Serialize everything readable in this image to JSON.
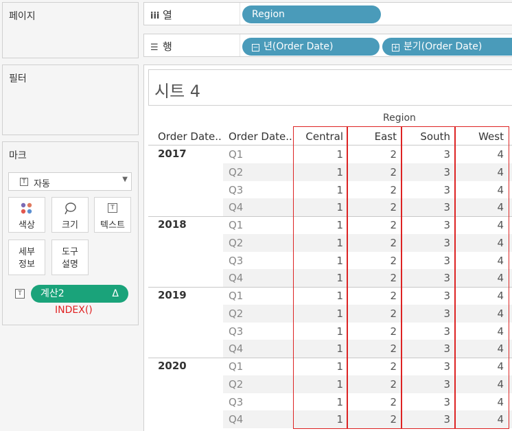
{
  "left_panels": {
    "pages_title": "페이지",
    "filters_title": "필터",
    "marks_title": "마크"
  },
  "marks": {
    "type_label": "자동",
    "buttons": {
      "color": "색상",
      "size": "크기",
      "text": "텍스트",
      "detail_line1": "세부",
      "detail_line2": "정보",
      "tooltip_line1": "도구",
      "tooltip_line2": "설명"
    },
    "calc_pill": "계산2",
    "calc_delta": "Δ",
    "calc_formula": "INDEX()"
  },
  "shelves": {
    "columns_label": "열",
    "rows_label": "행",
    "columns_pill": "Region",
    "rows_pill_1": "년(Order Date)",
    "rows_pill_2": "분기(Order Date)"
  },
  "sheet": {
    "title": "시트 4",
    "region_header": "Region",
    "row_header_1": "Order Date..",
    "row_header_2": "Order Date..",
    "columns": [
      "Central",
      "East",
      "South",
      "West"
    ],
    "years": [
      "2017",
      "2018",
      "2019",
      "2020"
    ],
    "quarters": [
      "Q1",
      "Q2",
      "Q3",
      "Q4"
    ],
    "values": [
      1,
      2,
      3,
      4
    ]
  },
  "colors": {
    "dimension_pill": "#4a9bba",
    "calc_pill": "#1aa37a",
    "highlight_box": "#dd2222"
  }
}
